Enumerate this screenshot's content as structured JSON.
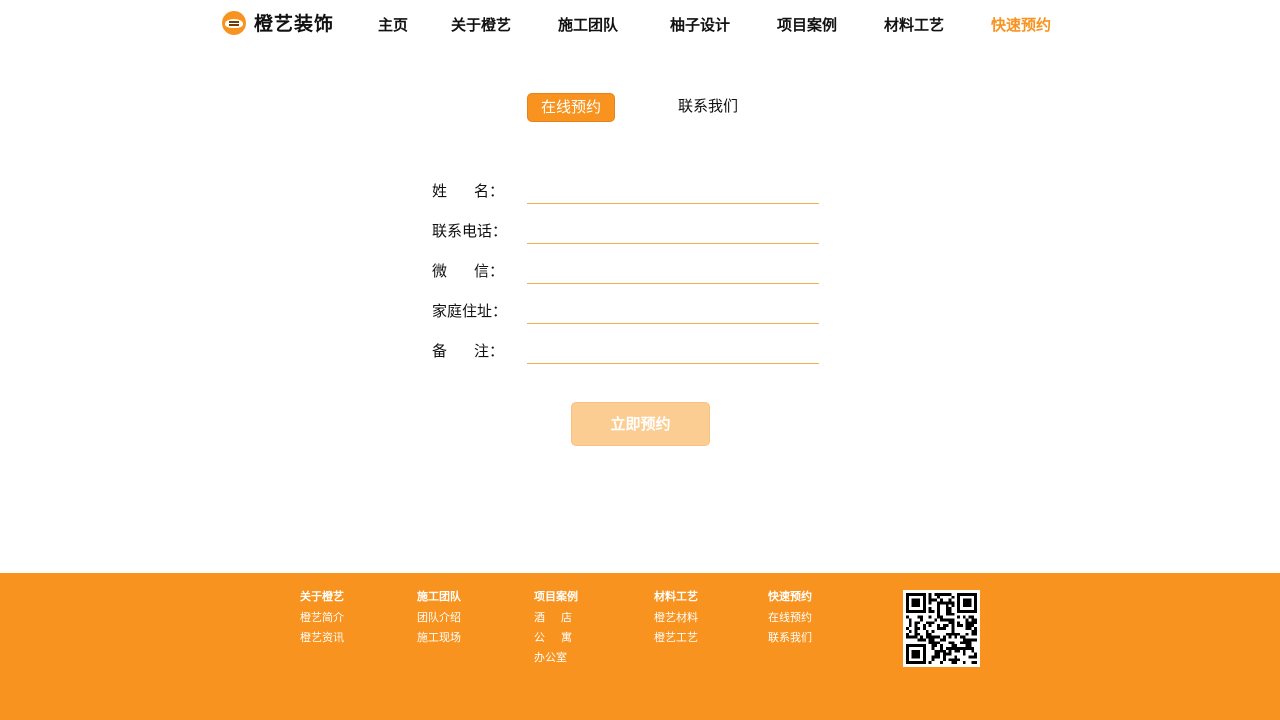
{
  "brand": {
    "name": "橙艺装饰",
    "accent": "#f7931e"
  },
  "nav": {
    "items": [
      {
        "label": "主页"
      },
      {
        "label": "关于橙艺"
      },
      {
        "label": "施工团队"
      },
      {
        "label": "柚子设计"
      },
      {
        "label": "项目案例"
      },
      {
        "label": "材料工艺"
      },
      {
        "label": "快速预约",
        "active": true
      }
    ]
  },
  "tabs": [
    {
      "label": "在线预约",
      "active": true
    },
    {
      "label": "联系我们",
      "active": false
    }
  ],
  "form": {
    "fields": [
      {
        "label": "姓名：",
        "parts": [
          "姓",
          "名："
        ],
        "value": ""
      },
      {
        "label": "联系电话：",
        "value": ""
      },
      {
        "label": "微信：",
        "parts": [
          "微",
          "信："
        ],
        "value": ""
      },
      {
        "label": "家庭住址：",
        "value": ""
      },
      {
        "label": "备注：",
        "parts": [
          "备",
          "注："
        ],
        "value": ""
      }
    ],
    "submit_label": "立即预约"
  },
  "footer": {
    "columns": [
      {
        "heading": "关于橙艺",
        "links": [
          "橙艺简介",
          "橙艺资讯"
        ]
      },
      {
        "heading": "施工团队",
        "links": [
          "团队介绍",
          "施工现场"
        ]
      },
      {
        "heading": "项目案例",
        "links": [
          {
            "parts": [
              "酒",
              "店"
            ]
          },
          {
            "parts": [
              "公",
              "寓"
            ]
          },
          "办公室"
        ]
      },
      {
        "heading": "材料工艺",
        "links": [
          "橙艺材料",
          "橙艺工艺"
        ]
      },
      {
        "heading": "快速预约",
        "links": [
          "在线预约",
          "联系我们"
        ]
      }
    ],
    "qr_icon": "qr-code-icon"
  }
}
